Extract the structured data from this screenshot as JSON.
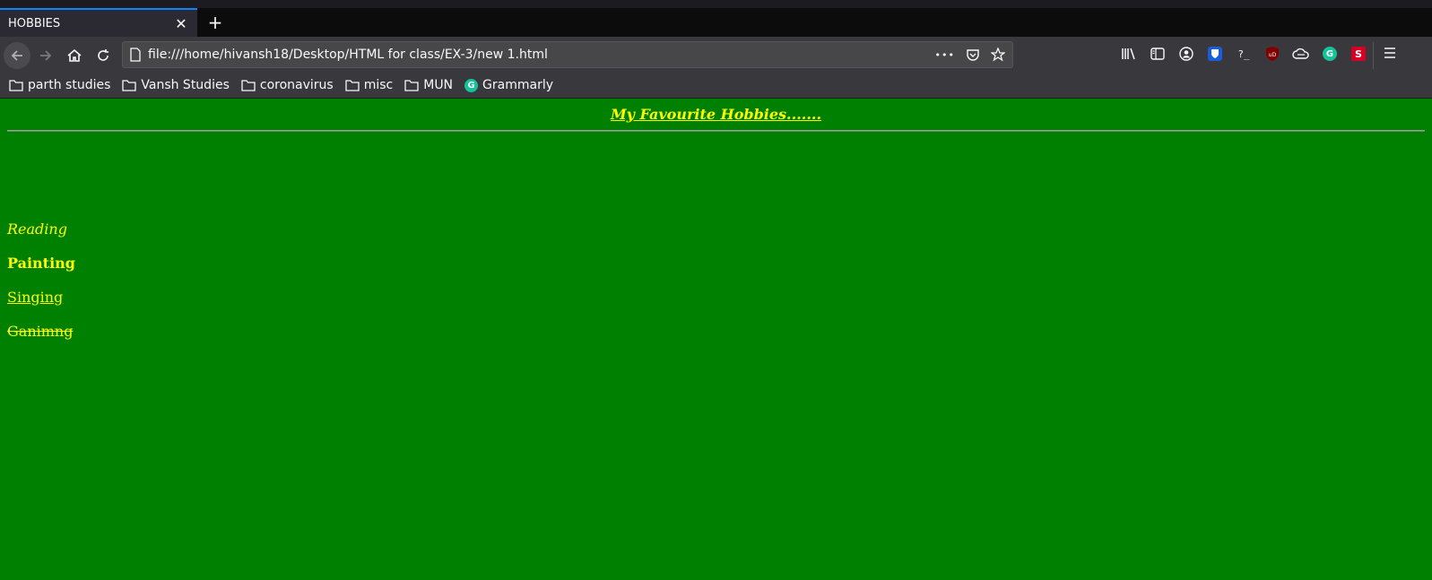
{
  "browser": {
    "tab_title": "HOBBIES",
    "close_symbol": "✕",
    "new_tab_symbol": "+",
    "url": "file:///home/hivansh18/Desktop/HTML for class/EX-3/new 1.html",
    "page_actions_symbol": "•••",
    "accent_color": "#0a84ff"
  },
  "bookmarks": [
    {
      "label": "parth studies",
      "icon": "folder-icon"
    },
    {
      "label": "Vansh Studies",
      "icon": "folder-icon"
    },
    {
      "label": "coronavirus",
      "icon": "folder-icon"
    },
    {
      "label": "misc",
      "icon": "folder-icon"
    },
    {
      "label": "MUN",
      "icon": "folder-icon"
    },
    {
      "label": "Grammarly",
      "icon": "grammarly-icon"
    }
  ],
  "extensions": {
    "shell_label": "?_",
    "ublock_label": "uD",
    "grammarly_label": "G",
    "s_label": "S"
  },
  "page": {
    "heading": "My Favourite Hobbies.......",
    "background_color": "#008000",
    "text_color": "#ffff00",
    "hobbies": [
      "Reading",
      "Painting",
      "Singing",
      "Ganimng"
    ]
  }
}
